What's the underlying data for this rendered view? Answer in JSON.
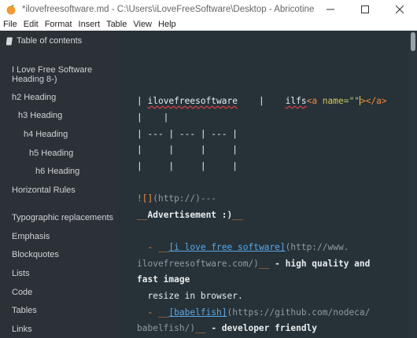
{
  "window": {
    "title": "*ilovefreesoftware.md - C:\\Users\\iLoveFreeSoftware\\Desktop - Abricotine",
    "controls": [
      "minimize-icon",
      "maximize-icon",
      "close-icon"
    ]
  },
  "menu": [
    "File",
    "Edit",
    "Format",
    "Insert",
    "Table",
    "View",
    "Help"
  ],
  "sidebar": {
    "header": "Table of contents",
    "items": [
      "I Love Free Software",
      "Heading 8-)",
      "h2 Heading",
      "h3 Heading",
      "h4 Heading",
      "h5 Heading",
      "h6 Heading",
      "Horizontal Rules",
      "Typographic replacements",
      "Emphasis",
      "Blockquotes",
      "Lists",
      "Code",
      "Tables",
      "Links"
    ]
  },
  "editor": {
    "l1": {
      "a": "| ",
      "b": "ilovefreesoftware",
      "c": "    |    ",
      "d": "ilfs",
      "e": "<a ",
      "f": "name",
      "g": "=\"\"",
      "h": "></a>"
    },
    "l2": "|    |",
    "l3": "| --- | --- | --- |",
    "l4": "|     |     |     |",
    "l5": "|     |     |     |",
    "l6": {
      "a": "![]",
      "b": "(http://)---"
    },
    "l7": {
      "a": "__",
      "b": "Advertisement :)",
      "c": "__"
    },
    "l8": {
      "a": "  - ",
      "b": "__",
      "c": "[i love free software]",
      "d": "(http://www."
    },
    "l9": {
      "a": "ilovefreesoftware.com/)",
      "b": "__",
      "c": " - high quality and"
    },
    "l10": "fast image",
    "l11": "  resize in browser.",
    "l12": {
      "a": "  - ",
      "b": "__",
      "c": "[babelfish]",
      "d": "(https://github.com/nodeca/"
    },
    "l13": {
      "a": "babelfish/)",
      "b": "__",
      "c": " - developer friendly"
    }
  },
  "colors": {
    "sidebar_bg": "#2c3138",
    "editor_bg": "#263238",
    "markup": "#f28a3c",
    "link": "#5aa7e6"
  }
}
